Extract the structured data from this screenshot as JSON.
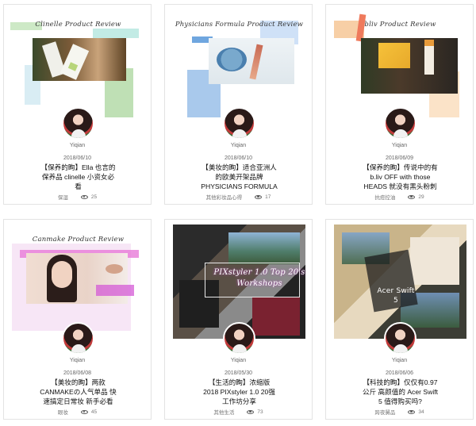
{
  "cards": [
    {
      "script": "Clinelle Product Review",
      "author": "Yiqian",
      "date": "2018/06/10",
      "title_lines": [
        "【保养的眴】Ella 也言的",
        "保养品 clinelle 小资女必",
        "看"
      ],
      "category": "保湿",
      "views": "25",
      "accent": "#bfe0b5"
    },
    {
      "script": "Physicians Formula Product Review",
      "author": "Yiqian",
      "date": "2018/06/10",
      "title_lines": [
        "【美妆的眴】适合亚洲人",
        "的欧美开架品牌",
        "PHYSICIANS FORMULA"
      ],
      "category": "其他彩妆品心得",
      "views": "17",
      "accent": "#a9c9ec"
    },
    {
      "script": "bliv Product Review",
      "author": "Yiqian",
      "date": "2018/06/09",
      "title_lines": [
        "【保养的眴】传说中的有",
        "b.liv OFF with those",
        "HEADS 就没有黑头粉刺"
      ],
      "category": "抗痘控油",
      "views": "29",
      "accent": "#f7d6b0"
    },
    {
      "script": "Canmake Product Review",
      "author": "Yiqian",
      "date": "2018/06/08",
      "title_lines": [
        "【美妆的眴】两款",
        "CANMAKEの人气单品 快",
        "速搞定日常妆 新手必看"
      ],
      "category": "眼妆",
      "views": "45",
      "accent": "#f1cdee"
    },
    {
      "script": "PIXstyler 1.0 Top 20's Workshops",
      "author": "Yiqian",
      "date": "2018/05/30",
      "title_lines": [
        "【生活的眴】浓缩版",
        "2018 PIXstyler 1.0 20强",
        "工作坊分享"
      ],
      "category": "其他生活",
      "views": "73",
      "accent": "#222222"
    },
    {
      "script": "Acer Swift 5",
      "author": "Yiqian",
      "date": "2018/06/06",
      "title_lines": [
        "【科技的眴】仅仅有0.97",
        "公斤 高颜值的 Acer Swift",
        "5 值得购买吗?"
      ],
      "category": "跨夜舅品",
      "views": "34",
      "accent": "#222222"
    }
  ]
}
